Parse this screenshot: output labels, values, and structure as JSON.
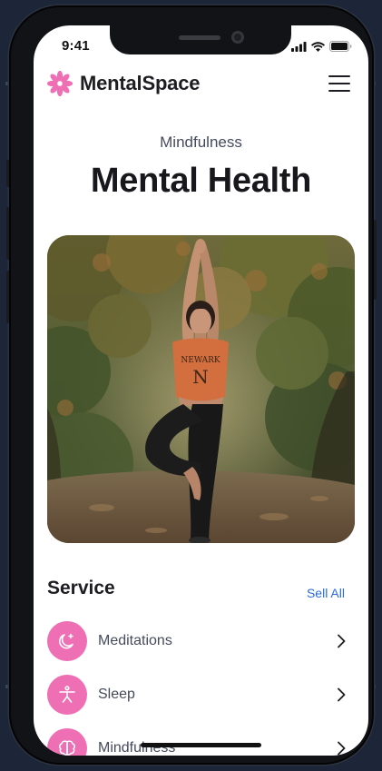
{
  "status_bar": {
    "time": "9:41"
  },
  "header": {
    "brand_name": "MentalSpace",
    "logo_icon": "flower-logo-icon",
    "menu_icon": "hamburger-menu-icon"
  },
  "hero": {
    "eyebrow": "Mindfulness",
    "title": "Mental Health",
    "image_alt": "Woman in orange NEWARK t-shirt doing tree pose yoga on a forest path"
  },
  "services": {
    "title": "Service",
    "see_all_label": "Sell All",
    "items": [
      {
        "label": "Meditations",
        "icon": "moon-sparkle-icon"
      },
      {
        "label": "Sleep",
        "icon": "person-stretch-icon"
      },
      {
        "label": "Mindfulness",
        "icon": "brain-icon"
      }
    ]
  },
  "colors": {
    "accent_pink": "#ee6fb4",
    "link_blue": "#2b6cd8",
    "frame_bg": "#1c2638"
  }
}
